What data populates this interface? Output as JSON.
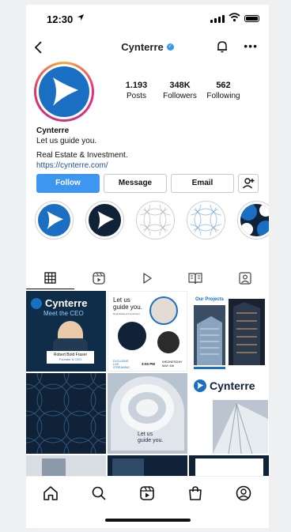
{
  "status_bar": {
    "time": "12:30"
  },
  "profile": {
    "username": "Cynterre",
    "stats": [
      {
        "value": "1.193",
        "label": "Posts"
      },
      {
        "value": "348K",
        "label": "Followers"
      },
      {
        "value": "562",
        "label": "Following"
      }
    ],
    "bio": {
      "name": "Cynterre",
      "line1": "Let us guide you.",
      "line2": "Real Estate & Investment.",
      "link": "https://cynterre.com/"
    }
  },
  "actions": {
    "follow": "Follow",
    "message": "Message",
    "email": "Email"
  },
  "posts": {
    "post1": {
      "brand": "Cynterre",
      "tagline": "Meet the CEO",
      "person": "Robert Bold Fraser",
      "role": "Founder & CEO"
    },
    "post2": {
      "title_line1": "Let us",
      "title_line2": "guide you.",
      "small": "Real Estate & Investment",
      "tag": "EXCLUSIVE LIVE STREAMING",
      "time": "3:00 PM",
      "day": "WEDNESDAY",
      "date": "MAY 4th"
    },
    "post3": {
      "title": "Our Projects"
    },
    "post5": {
      "line1": "Let us",
      "line2": "guide you."
    },
    "post6": {
      "brand": "Cynterre"
    }
  },
  "colors": {
    "brand_blue": "#1a6fc2",
    "dark_navy": "#0f2237",
    "follow_blue": "#3d97f1"
  }
}
